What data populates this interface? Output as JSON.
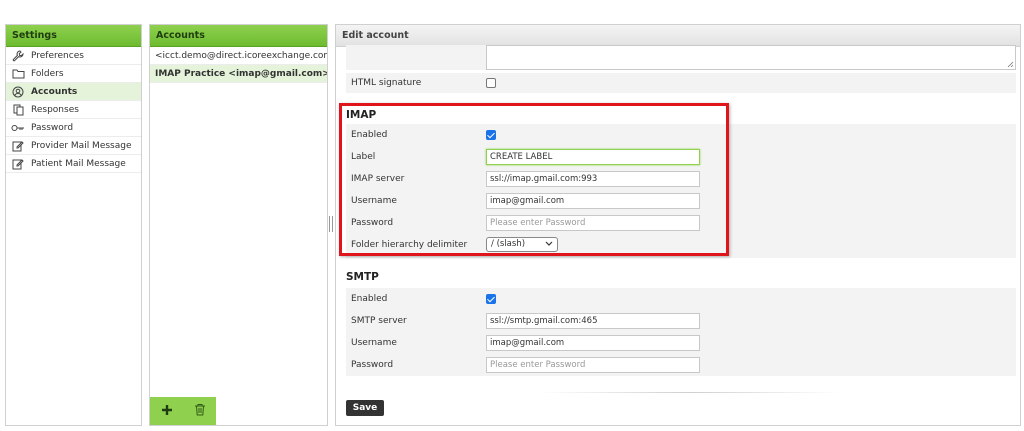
{
  "settings": {
    "title": "Settings",
    "items": [
      {
        "label": "Preferences",
        "icon": "wrench-icon"
      },
      {
        "label": "Folders",
        "icon": "folder-icon"
      },
      {
        "label": "Accounts",
        "icon": "user-circle-icon",
        "selected": true
      },
      {
        "label": "Responses",
        "icon": "copy-icon"
      },
      {
        "label": "Password",
        "icon": "key-icon"
      },
      {
        "label": "Provider Mail Message",
        "icon": "edit-icon"
      },
      {
        "label": "Patient Mail Message",
        "icon": "edit-icon"
      }
    ]
  },
  "accounts": {
    "title": "Accounts",
    "items": [
      {
        "label": "<icct.demo@direct.icoreexchange.com>"
      },
      {
        "label": "IMAP Practice <imap@gmail.com>",
        "selected": true
      }
    ],
    "add_icon": "plus-icon",
    "delete_icon": "trash-icon"
  },
  "edit": {
    "title": "Edit account",
    "html_signature_label": "HTML signature",
    "imap": {
      "title": "IMAP",
      "enabled_label": "Enabled",
      "label_label": "Label",
      "label_value": "CREATE LABEL",
      "server_label": "IMAP server",
      "server_value": "ssl://imap.gmail.com:993",
      "username_label": "Username",
      "username_value": "imap@gmail.com",
      "password_label": "Password",
      "password_placeholder": "Please enter Password",
      "delimiter_label": "Folder hierarchy delimiter",
      "delimiter_value": "/ (slash)"
    },
    "smtp": {
      "title": "SMTP",
      "enabled_label": "Enabled",
      "server_label": "SMTP server",
      "server_value": "ssl://smtp.gmail.com:465",
      "username_label": "Username",
      "username_value": "imap@gmail.com",
      "password_label": "Password",
      "password_placeholder": "Please enter Password"
    },
    "save_label": "Save"
  },
  "colors": {
    "header_green": "#6dbb2f",
    "selected_bg": "#e4f3d9",
    "highlight_red": "#e0141b",
    "checkbox_blue": "#1a73e8"
  }
}
